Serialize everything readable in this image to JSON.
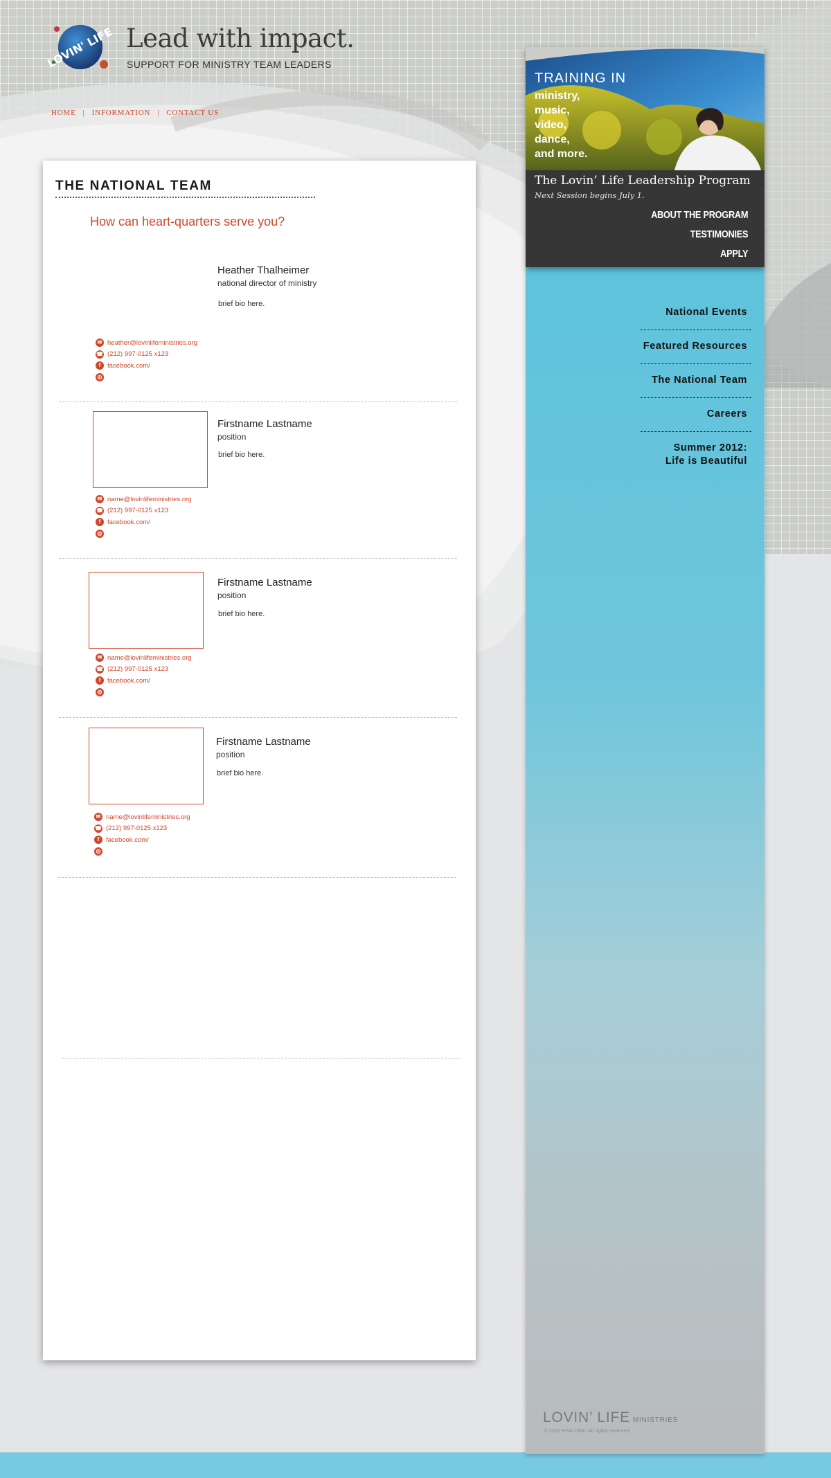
{
  "header": {
    "tagline": "Lead with impact.",
    "subtagline": "SUPPORT FOR MINISTRY TEAM LEADERS",
    "logo_text": "LOVIN' LIFE"
  },
  "topnav": {
    "items": [
      "HOME",
      "INFORMATION",
      "CONTACT US"
    ],
    "separator": "|"
  },
  "main": {
    "title": "THE NATIONAL TEAM",
    "intro": "How can heart-quarters serve you?",
    "members": [
      {
        "name": "Heather Thalheimer",
        "role": "national director of ministry",
        "bio": "brief bio here.",
        "email": "heather@lovinlifeministries.org",
        "phone": "(212) 997-0125 x123",
        "facebook": "facebook.com/"
      },
      {
        "name": "Firstname Lastname",
        "role": "position",
        "bio": "brief bio here.",
        "email": "name@lovinlifeministries.org",
        "phone": "(212) 997-0125 x123",
        "facebook": "facebook.com/"
      },
      {
        "name": "Firstname Lastname",
        "role": "position",
        "bio": "brief bio here.",
        "email": "name@lovinlifeministries.org",
        "phone": "(212) 997-0125 x123",
        "facebook": "facebook.com/"
      },
      {
        "name": "Firstname Lastname",
        "role": "position",
        "bio": "brief bio here.",
        "email": "name@lovinlifeministries.org",
        "phone": "(212) 997-0125 x123",
        "facebook": "facebook.com/"
      }
    ]
  },
  "promo": {
    "heading": "TRAINING IN",
    "items": [
      "ministry,",
      "music,",
      "video,",
      "dance,",
      "and more."
    ],
    "program_title": "The Lovin’ Life Leadership Program",
    "program_sub": "Next Session begins July 1.",
    "links": [
      "ABOUT THE PROGRAM",
      "TESTIMONIES",
      "APPLY"
    ]
  },
  "sidebar": {
    "nav": [
      "National Events",
      "Featured Resources",
      "The National Team",
      "Careers"
    ],
    "highlight_line1": "Summer 2012:",
    "highlight_line2": "Life is Beautiful"
  },
  "footer": {
    "brand": "LOVIN’ LIFE",
    "brand_sub": "MINISTRIES",
    "copyright": "© 2012 HSA-UWC All rights reserved"
  },
  "icons": {
    "email": "email-icon",
    "phone": "phone-icon",
    "facebook": "facebook-icon",
    "web": "web-icon"
  },
  "colors": {
    "accent": "#d0462a",
    "sidebar_blue": "#5ec3dc",
    "promo_dark": "#363636",
    "bottom_band": "#78c9e2"
  }
}
